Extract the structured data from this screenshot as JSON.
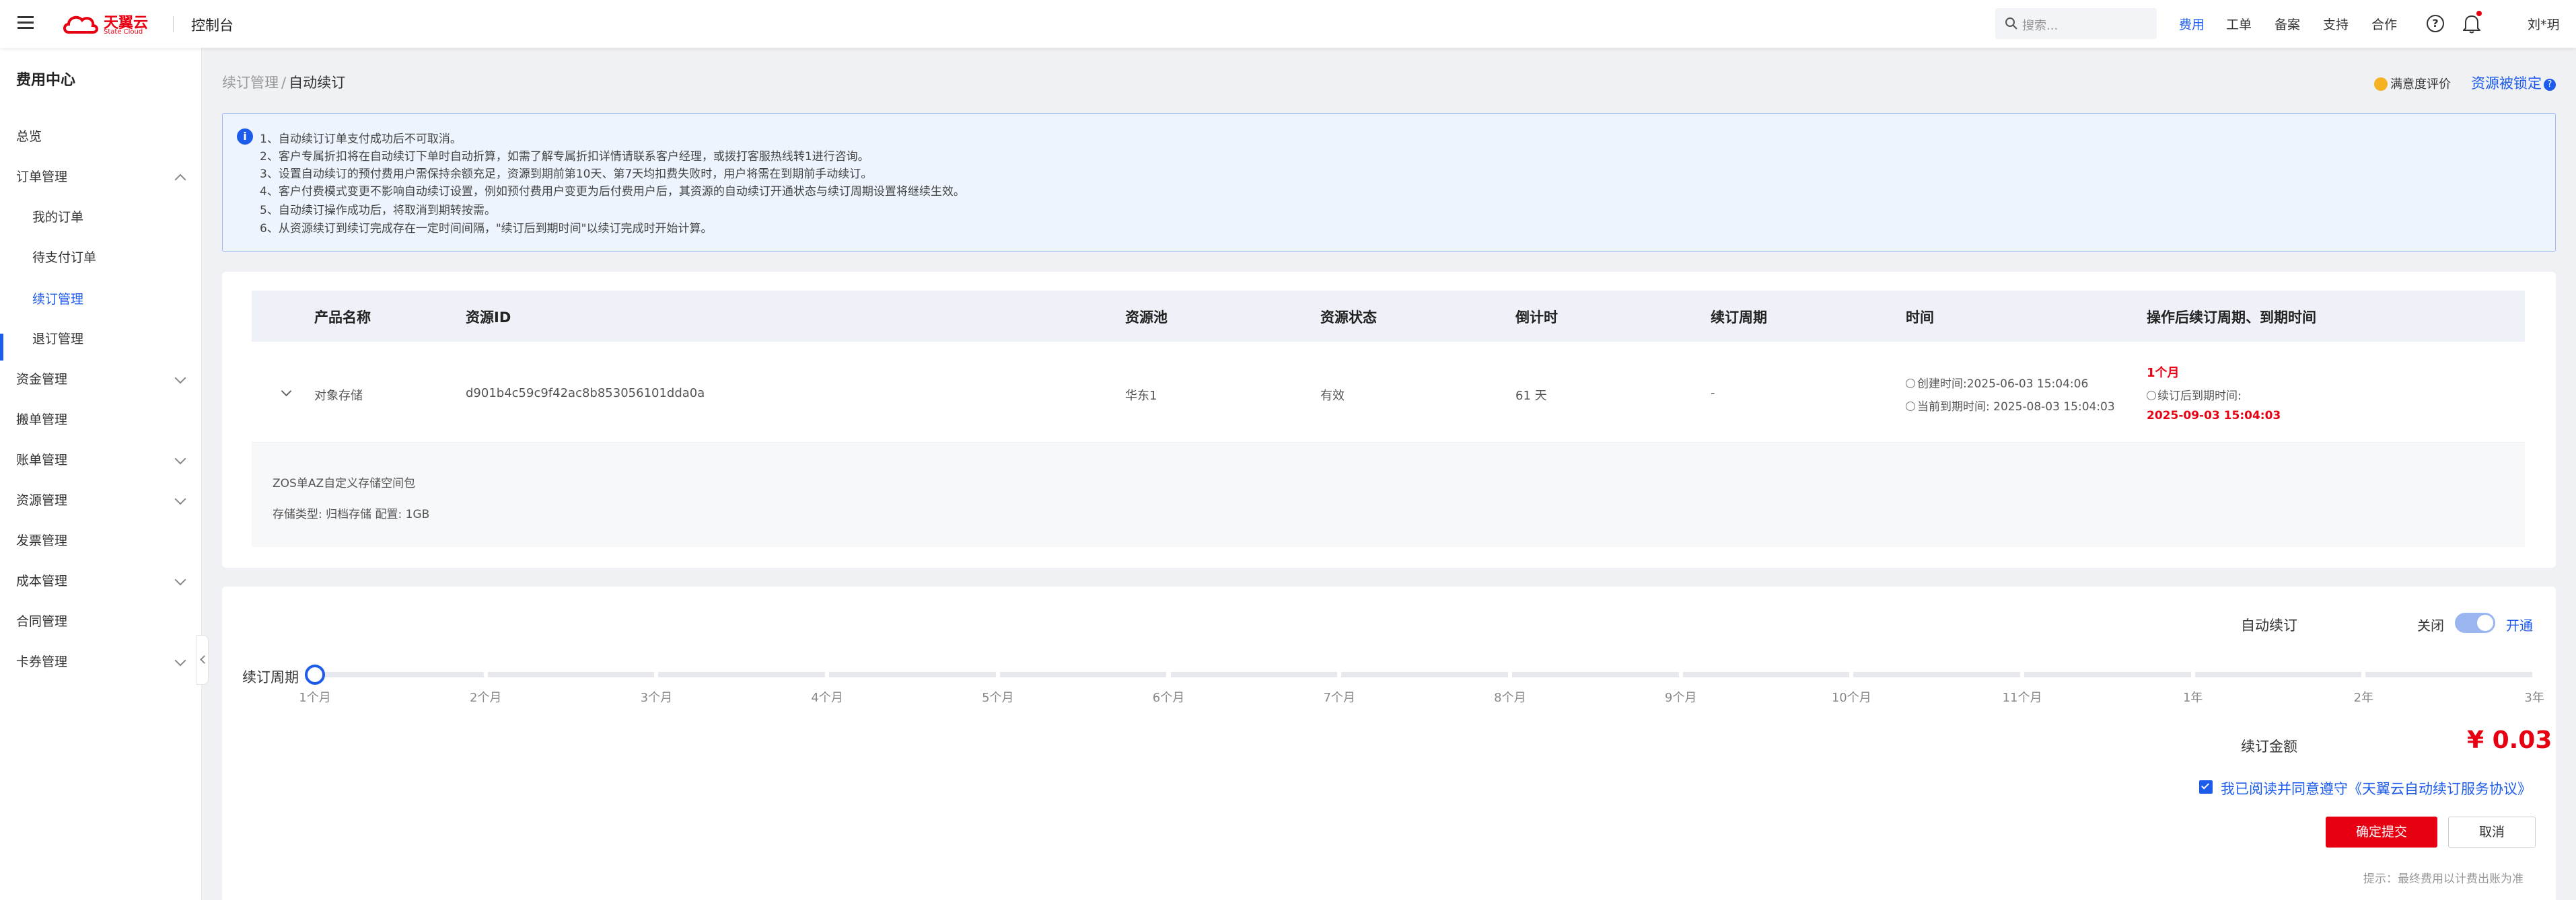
{
  "header": {
    "brand_cn": "天翼云",
    "brand_en": "State Cloud",
    "console": "控制台",
    "search_placeholder": "搜索...",
    "nav": [
      "费用",
      "工单",
      "备案",
      "支持",
      "合作"
    ],
    "user": "刘*玥",
    "colors": {
      "brand": "#e60012",
      "accent": "#1d5bea"
    }
  },
  "sidebar": {
    "title": "费用中心",
    "items": [
      {
        "label": "总览"
      },
      {
        "label": "订单管理"
      },
      {
        "label": "我的订单"
      },
      {
        "label": "待支付订单"
      },
      {
        "label": "续订管理"
      },
      {
        "label": "退订管理"
      },
      {
        "label": "资金管理"
      },
      {
        "label": "搬单管理"
      },
      {
        "label": "账单管理"
      },
      {
        "label": "资源管理"
      },
      {
        "label": "发票管理"
      },
      {
        "label": "成本管理"
      },
      {
        "label": "合同管理"
      },
      {
        "label": "卡券管理"
      }
    ]
  },
  "breadcrumb": {
    "parent": "续订管理",
    "sep": "/",
    "current": "自动续订"
  },
  "top_actions": {
    "rating": "满意度评价",
    "lock": "资源被锁定"
  },
  "notice": [
    "1、自动续订订单支付成功后不可取消。",
    "2、客户专属折扣将在自动续订下单时自动折算，如需了解专属折扣详情请联系客户经理，或拨打客服热线转1进行咨询。",
    "3、设置自动续订的预付费用户需保持余额充足，资源到期前第10天、第7天均扣费失败时，用户将需在到期前手动续订。",
    "4、客户付费模式变更不影响自动续订设置，例如预付费用户变更为后付费用户后，其资源的自动续订开通状态与续订周期设置将继续生效。",
    "5、自动续订操作成功后，将取消到期转按需。",
    "6、从资源续订到续订完成存在一定时间间隔，\"续订后到期时间\"以续订完成时开始计算。"
  ],
  "table": {
    "headers": [
      "产品名称",
      "资源ID",
      "资源池",
      "资源状态",
      "倒计时",
      "续订周期",
      "时间",
      "操作后续订周期、到期时间"
    ],
    "row": {
      "product": "对象存储",
      "resource_id": "d901b4c59c9f42ac8b853056101dda0a",
      "pool": "华东1",
      "status": "有效",
      "countdown": "61 天",
      "period": "-",
      "created": "创建时间:2025-06-03 15:04:06",
      "expire": "当前到期时间: 2025-08-03 15:04:03",
      "after_period": "1个月",
      "after_label": "续订后到期时间:",
      "after_time": "2025-09-03 15:04:03"
    },
    "detail": {
      "name": "ZOS单AZ自定义存储空间包",
      "spec": "存储类型: 归档存储 配置: 1GB"
    }
  },
  "renew": {
    "auto_label": "自动续订",
    "off_label": "关闭",
    "on_label": "开通",
    "period_label": "续订周期",
    "ticks": [
      "1个月",
      "2个月",
      "3个月",
      "4个月",
      "5个月",
      "6个月",
      "7个月",
      "8个月",
      "9个月",
      "10个月",
      "11个月",
      "1年",
      "2年",
      "3年"
    ],
    "selected_index": 0,
    "amount_label": "续订金额",
    "amount": "¥ 0.03",
    "agree_text": "我已阅读并同意遵守",
    "agree_link": "《天翼云自动续订服务协议》",
    "submit": "确定提交",
    "cancel": "取消",
    "hint": "提示：最终费用以计费出账为准"
  }
}
